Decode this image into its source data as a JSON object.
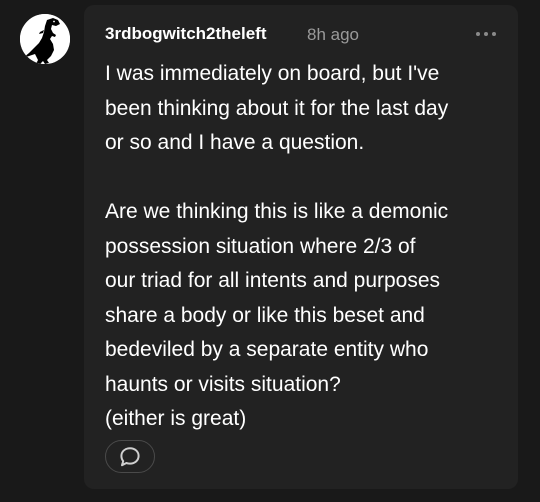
{
  "post": {
    "author": {
      "username": "3rdbogwitch2theleft",
      "avatar_icon": "dinosaur-silhouette-icon"
    },
    "timestamp": "8h ago",
    "menu_icon": "more-horizontal-icon",
    "body_lines": [
      "I was immediately on board, but I've",
      "been thinking about it for the last day",
      "or so and I have a question.",
      "",
      "Are we thinking this is like a demonic",
      "possession situation where 2/3 of",
      "our triad for all intents and purposes",
      "share a body or like this beset and",
      "bedeviled by a separate entity who",
      "haunts or visits situation?",
      "(either is great)"
    ],
    "reply_icon": "speech-bubble-icon"
  },
  "colors": {
    "background": "#191919",
    "card": "#222222",
    "text": "#ffffff",
    "muted": "#9a9a9a"
  }
}
